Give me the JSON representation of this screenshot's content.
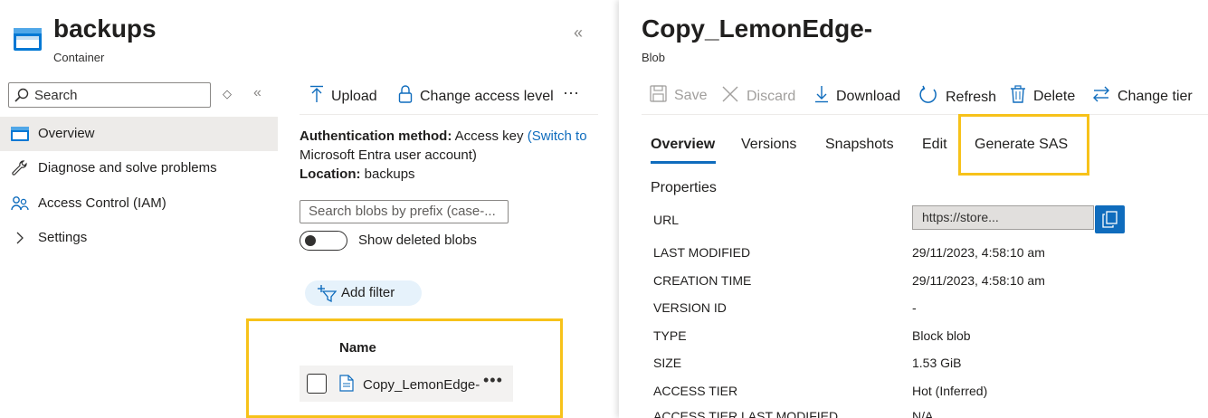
{
  "container": {
    "title": "backups",
    "subtitle": "Container",
    "collapse_glyph": "«"
  },
  "sidebar": {
    "search_placeholder": "Search",
    "updown_glyph": "◇",
    "collapse_glyph": "«",
    "items": [
      {
        "label": "Overview",
        "icon": "container-icon",
        "active": true
      },
      {
        "label": "Diagnose and solve problems",
        "icon": "wrench-icon"
      },
      {
        "label": "Access Control (IAM)",
        "icon": "people-icon"
      },
      {
        "label": "Settings",
        "icon": "chevron-right-icon"
      }
    ]
  },
  "toolbar": {
    "upload": "Upload",
    "change_access": "Change access level",
    "more": "···"
  },
  "info": {
    "auth_label": "Authentication method:",
    "auth_value": "Access key",
    "auth_link_1": "(Switch to",
    "auth_link_2": "Microsoft Entra user account)",
    "location_label": "Location:",
    "location_value": "backups"
  },
  "blob_search": {
    "placeholder": "Search blobs by prefix (case-..."
  },
  "show_deleted": {
    "label": "Show deleted blobs",
    "checked": false
  },
  "add_filter": "Add filter",
  "blob_list": {
    "column_name": "Name",
    "rows": [
      {
        "name": "Copy_LemonEdge-",
        "more": "•••"
      }
    ]
  },
  "blob": {
    "title": "Copy_LemonEdge-",
    "subtitle": "Blob",
    "toolbar": {
      "save": "Save",
      "discard": "Discard",
      "download": "Download",
      "refresh": "Refresh",
      "delete": "Delete",
      "change_tier": "Change tier"
    },
    "tabs": [
      "Overview",
      "Versions",
      "Snapshots",
      "Edit",
      "Generate SAS"
    ],
    "active_tab": "Overview",
    "properties_heading": "Properties",
    "properties": [
      {
        "key": "URL",
        "value": "https://store..."
      },
      {
        "key": "LAST MODIFIED",
        "value": "29/11/2023, 4:58:10 am"
      },
      {
        "key": "CREATION TIME",
        "value": "29/11/2023, 4:58:10 am"
      },
      {
        "key": "VERSION ID",
        "value": "-"
      },
      {
        "key": "TYPE",
        "value": "Block blob"
      },
      {
        "key": "SIZE",
        "value": "1.53 GiB"
      },
      {
        "key": "ACCESS TIER",
        "value": "Hot (Inferred)"
      },
      {
        "key": "ACCESS TIER LAST MODIFIED",
        "value": "N/A"
      }
    ]
  },
  "colors": {
    "accent": "#0f6cbd",
    "highlight": "#f7c21a",
    "active_nav": "#edebe9"
  }
}
